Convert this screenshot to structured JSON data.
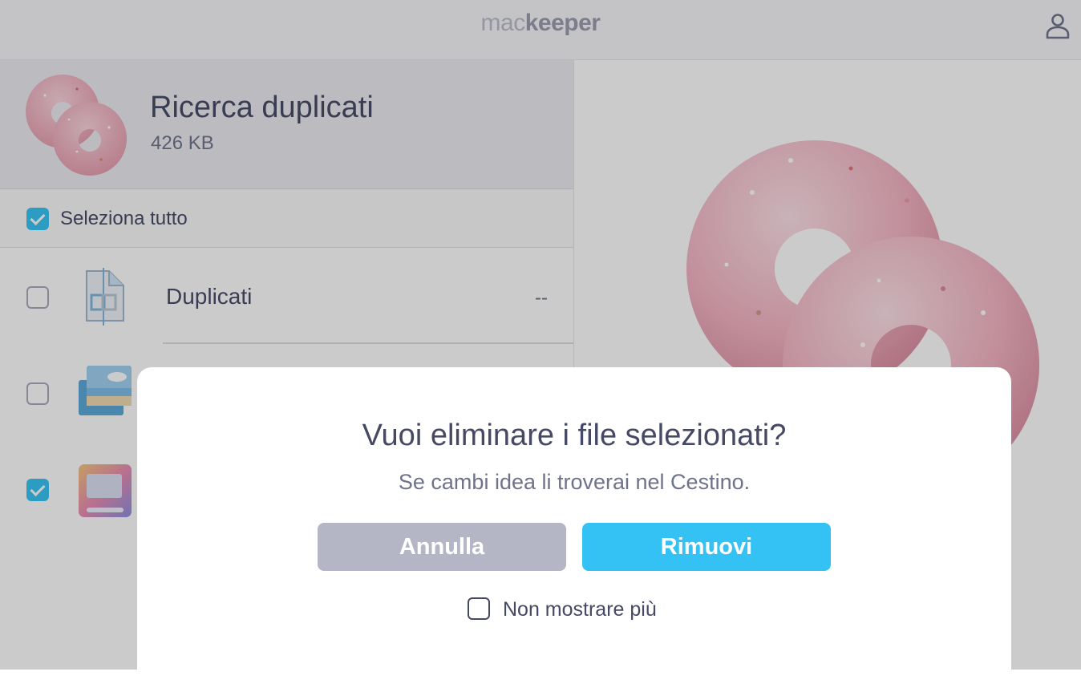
{
  "app": {
    "logo_light": "mac",
    "logo_bold": "keeper"
  },
  "header": {
    "title": "Ricerca duplicati",
    "size": "426 KB"
  },
  "select_all": {
    "label": "Seleziona tutto",
    "checked": true
  },
  "categories": [
    {
      "label": "Duplicati",
      "size": "--",
      "checked": false,
      "icon": "duplicate-file-icon"
    },
    {
      "label": "",
      "size": "",
      "checked": false,
      "icon": "photos-icon"
    },
    {
      "label": "",
      "size": "",
      "checked": true,
      "icon": "screenshot-icon"
    }
  ],
  "dialog": {
    "title": "Vuoi eliminare i file selezionati?",
    "subtitle": "Se cambi idea li troverai nel Cestino.",
    "cancel_label": "Annulla",
    "remove_label": "Rimuovi",
    "dont_show_label": "Non mostrare più",
    "dont_show_checked": false
  },
  "colors": {
    "accent": "#34c2f4",
    "cancel": "#b5b6c5",
    "text": "#454963",
    "donut": "#f3b8c4"
  }
}
